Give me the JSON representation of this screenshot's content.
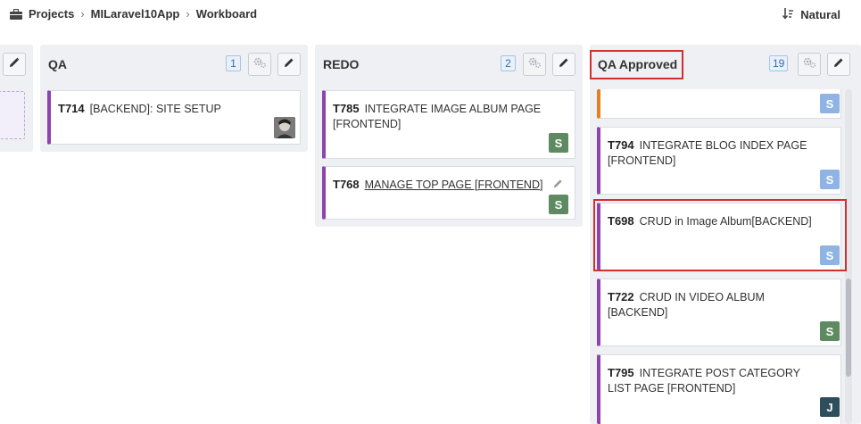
{
  "breadcrumb": {
    "projects": "Projects",
    "app": "MILaravel10App",
    "page": "Workboard"
  },
  "sort": {
    "label": "Natural"
  },
  "icons": {
    "briefcase": "briefcase-icon",
    "sort": "sort-icon",
    "gear": "gear-icon",
    "pencil": "pencil-icon"
  },
  "colors": {
    "lane_bg": "#eef0f3",
    "accent_purple": "#8e44ad",
    "accent_orange": "#e67e22",
    "highlight_red": "#d32f2f",
    "badge_blue": "#3a6ea5"
  },
  "columns": [
    {
      "title": "QA",
      "count": "1",
      "cards": [
        {
          "id": "T714",
          "title": "[BACKEND]: SITE SETUP",
          "avatar": "photo"
        }
      ]
    },
    {
      "title": "REDO",
      "count": "2",
      "cards": [
        {
          "id": "T785",
          "title": "INTEGRATE IMAGE ALBUM PAGE [FRONTEND]",
          "avatar": "S"
        },
        {
          "id": "T768",
          "title": "MANAGE TOP PAGE [FRONTEND]",
          "avatar": "S"
        }
      ]
    },
    {
      "title": "QA Approved",
      "count": "19",
      "cards": [
        {
          "id": "",
          "title": "",
          "avatar": "S"
        },
        {
          "id": "T794",
          "title": "INTEGRATE BLOG INDEX PAGE [FRONTEND]",
          "avatar": "S"
        },
        {
          "id": "T698",
          "title": "CRUD in Image Album[BACKEND]",
          "avatar": "S"
        },
        {
          "id": "T722",
          "title": "CRUD IN VIDEO ALBUM [BACKEND]",
          "avatar": "S"
        },
        {
          "id": "T795",
          "title": "INTEGRATE POST CATEGORY LIST PAGE [FRONTEND]",
          "avatar": "J"
        }
      ]
    }
  ]
}
